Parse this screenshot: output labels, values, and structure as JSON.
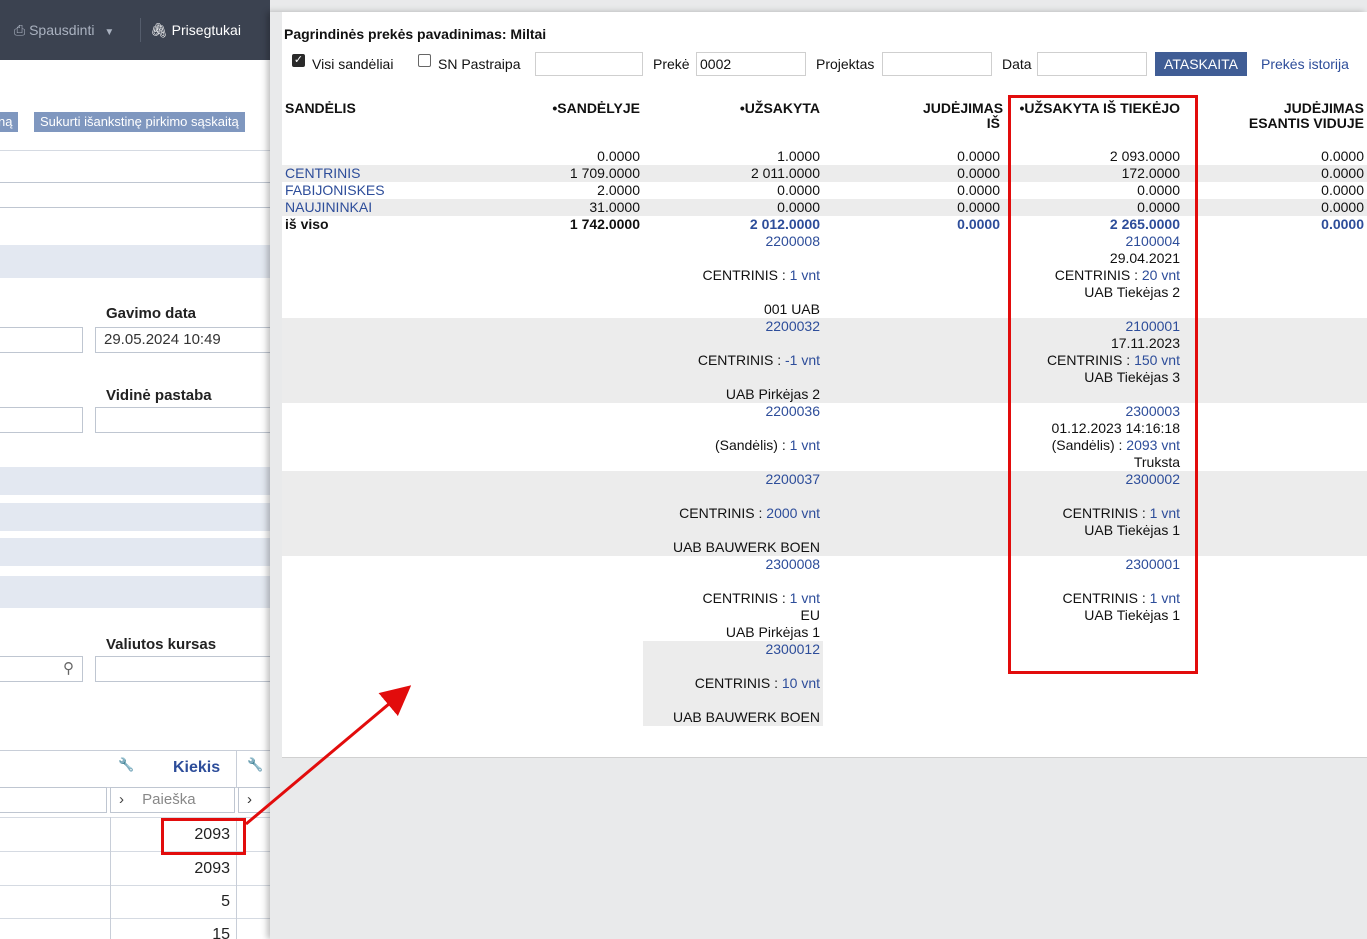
{
  "background": {
    "toolbar": {
      "print_label": "Spausdinti",
      "attach_label": "Prisegtukai"
    },
    "buttons": [
      "ną",
      "Sukurti išankstinę pirkimo sąskaitą"
    ],
    "gavimo_data": {
      "label": "Gavimo data",
      "value": "29.05.2024 10:49"
    },
    "vidine_pastaba": {
      "label": "Vidinė pastaba"
    },
    "valiutos_kursas": {
      "label": "Valiutos kursas"
    },
    "grid": {
      "header": "Kiekis",
      "search_placeholder": "Paieška",
      "values": [
        "2093",
        "2093",
        "5",
        "15"
      ]
    }
  },
  "popup": {
    "title": "Pagrindinės prekės pavadinimas: Miltai",
    "filters": {
      "visi_sandeliai": "Visi sandėliai",
      "sn_pastraipa": "SN Pastraipa",
      "preke_label": "Prekė",
      "preke_value": "0002",
      "projektas_label": "Projektas",
      "data_label": "Data",
      "report_button": "ATASKAITA",
      "history_link": "Prekės istorija"
    },
    "columns": [
      "SANDĖLIS",
      "•SANDĖLYJE",
      "•UŽSAKYTA",
      "JUDĖJIMAS IŠ",
      "•UŽSAKYTA IŠ TIEKĖJO",
      "JUDĖJIMAS ESANTIS VIDUJE"
    ],
    "rows": [
      {
        "name": "",
        "sandelyje": "0.0000",
        "uzsakyta": "1.0000",
        "judejimas_is": "0.0000",
        "is_tiekejo": "2 093.0000",
        "viduje": "0.0000"
      },
      {
        "name": "CENTRINIS",
        "sandelyje": "1 709.0000",
        "uzsakyta": "2 011.0000",
        "judejimas_is": "0.0000",
        "is_tiekejo": "172.0000",
        "viduje": "0.0000"
      },
      {
        "name": "FABIJONISKES",
        "sandelyje": "2.0000",
        "uzsakyta": "0.0000",
        "judejimas_is": "0.0000",
        "is_tiekejo": "0.0000",
        "viduje": "0.0000"
      },
      {
        "name": "NAUJININKAI",
        "sandelyje": "31.0000",
        "uzsakyta": "0.0000",
        "judejimas_is": "0.0000",
        "is_tiekejo": "0.0000",
        "viduje": "0.0000"
      }
    ],
    "total": {
      "name": "iš viso",
      "sandelyje": "1 742.0000",
      "uzsakyta": "2 012.0000",
      "judejimas_is": "0.0000",
      "is_tiekejo": "2 265.0000",
      "viduje": "0.0000"
    },
    "details": [
      {
        "order": {
          "doc": "2200008",
          "wh": "CENTRINIS",
          "qty": "1 vnt",
          "l2": "",
          "l3": "001 UAB"
        },
        "supplier": {
          "doc": "2100004",
          "date": "29.04.2021",
          "wh": "CENTRINIS",
          "qty": "20 vnt",
          "party": "UAB Tiekėjas 2"
        }
      },
      {
        "order": {
          "doc": "2200032",
          "wh": "CENTRINIS",
          "qty": "-1 vnt",
          "l2": "",
          "l3": "UAB Pirkėjas 2"
        },
        "supplier": {
          "doc": "2100001",
          "date": "17.11.2023",
          "wh": "CENTRINIS",
          "qty": "150 vnt",
          "party": "UAB Tiekėjas 3"
        }
      },
      {
        "order": {
          "doc": "2200036",
          "wh": "(Sandėlis)",
          "qty": "1 vnt",
          "l2": "",
          "l3": ""
        },
        "supplier": {
          "doc": "2300003",
          "date": "01.12.2023 14:16:18",
          "wh": "(Sandėlis)",
          "qty": "2093 vnt",
          "party": "Truksta"
        }
      },
      {
        "order": {
          "doc": "2200037",
          "wh": "CENTRINIS",
          "qty": "2000 vnt",
          "l2": "",
          "l3": "UAB BAUWERK BOEN"
        },
        "supplier": {
          "doc": "2300002",
          "date": "",
          "wh": "CENTRINIS",
          "qty": "1 vnt",
          "party": "UAB Tiekėjas 1"
        }
      },
      {
        "order": {
          "doc": "2300008",
          "wh": "CENTRINIS",
          "qty": "1 vnt",
          "l2": "EU",
          "l3": "UAB Pirkėjas 1"
        },
        "supplier": {
          "doc": "2300001",
          "date": "",
          "wh": "CENTRINIS",
          "qty": "1 vnt",
          "party": "UAB Tiekėjas 1"
        }
      },
      {
        "order": {
          "doc": "2300012",
          "wh": "CENTRINIS",
          "qty": "10 vnt",
          "l2": "",
          "l3": "UAB BAUWERK BOEN"
        },
        "supplier": null
      }
    ]
  },
  "colors": {
    "highlight": "#e20c0c",
    "link": "#2d4d9a",
    "button": "#405d95"
  }
}
